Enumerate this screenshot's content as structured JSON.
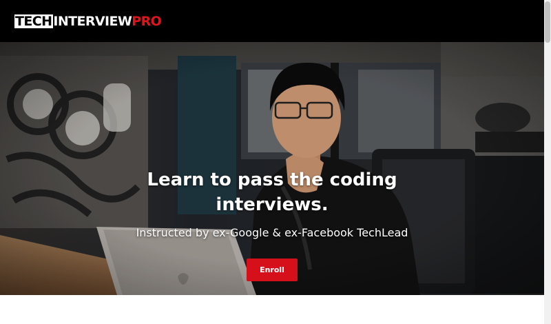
{
  "header": {
    "logo": {
      "part1": "TECH",
      "part2": "INTERVIEW",
      "part3": "PRO"
    }
  },
  "hero": {
    "title": "Learn to pass the coding interviews.",
    "subtitle": "Instructed by ex-Google & ex-Facebook TechLead",
    "cta_label": "Enroll"
  },
  "colors": {
    "header_bg": "#000000",
    "brand_red": "#d5101a",
    "logo_pro": "#e1141e"
  },
  "icons": [
    "scrollbar-thumb"
  ]
}
